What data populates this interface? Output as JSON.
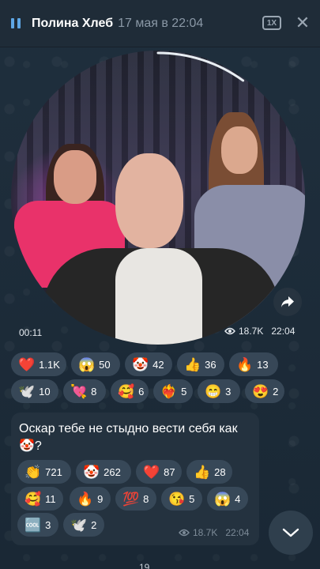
{
  "header": {
    "pause_icon": "pause-icon",
    "name": "Полина Хлеб",
    "date": "17 мая в 22:04",
    "speed": "1X",
    "close_icon": "close-icon",
    "accent": "#5ea7e6"
  },
  "video": {
    "elapsed": "00:11",
    "views": "18.7K",
    "time": "22:04",
    "progress_fraction": 0.1,
    "share_icon": "share-arrow-icon"
  },
  "reactions": [
    {
      "emoji": "❤️",
      "count": "1.1K"
    },
    {
      "emoji": "😱",
      "count": "50"
    },
    {
      "emoji": "🤡",
      "count": "42"
    },
    {
      "emoji": "👍",
      "count": "36"
    },
    {
      "emoji": "🔥",
      "count": "13"
    },
    {
      "emoji": "🕊️",
      "count": "10"
    },
    {
      "emoji": "💘",
      "count": "8"
    },
    {
      "emoji": "🥰",
      "count": "6"
    },
    {
      "emoji": "❤️‍🔥",
      "count": "5"
    },
    {
      "emoji": "😁",
      "count": "3"
    },
    {
      "emoji": "😍",
      "count": "2"
    }
  ],
  "comment": {
    "text": "Оскар тебе не стыдно вести себя как 🤡?",
    "reactions": [
      {
        "emoji": "👏",
        "count": "721"
      },
      {
        "emoji": "🤡",
        "count": "262"
      },
      {
        "emoji": "❤️",
        "count": "87"
      },
      {
        "emoji": "👍",
        "count": "28"
      },
      {
        "emoji": "🥰",
        "count": "11"
      },
      {
        "emoji": "🔥",
        "count": "9"
      },
      {
        "emoji": "💯",
        "count": "8"
      },
      {
        "emoji": "😘",
        "count": "5"
      },
      {
        "emoji": "😱",
        "count": "4"
      },
      {
        "emoji": "🆒",
        "count": "3"
      },
      {
        "emoji": "🕊️",
        "count": "2"
      }
    ],
    "views": "18.7K",
    "time": "22:04"
  },
  "scroll_down_icon": "chevron-down-icon",
  "bottom_partial": "19"
}
